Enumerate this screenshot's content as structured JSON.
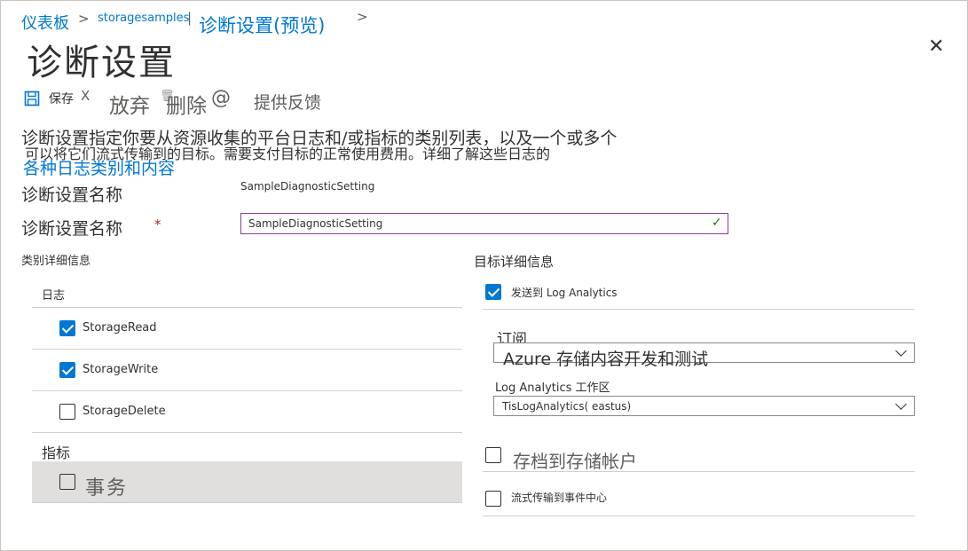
{
  "breadcrumb": {
    "items": [
      "仪表板",
      "storagesamples",
      "诊断设置(预览)"
    ],
    "separators": [
      ">",
      "|",
      ">"
    ]
  },
  "page_title": "诊断设置",
  "toolbar": {
    "save_icon": "save-icon",
    "save_label": "保存",
    "discard_x": "X",
    "discard_label": "放弃",
    "delete_icon": "trash-icon",
    "delete_label": "删除",
    "feedback_icon": "@",
    "feedback_label": "提供反馈"
  },
  "description": {
    "line1": "诊断设置指定你要从资源收集的平台日志和/或指标的类别列表，以及一个或多个",
    "line2": "可以将它们流式传输到的目标。需要支付目标的正常使用费用。详细了解这些日志的",
    "link": "各种日志类别和内容"
  },
  "setting_name": {
    "label": "诊断设置名称",
    "value": "SampleDiagnosticSetting",
    "label2": "诊断设置名称",
    "required_mark": "*",
    "input_value": "SampleDiagnosticSetting"
  },
  "category_details": {
    "header": "类别详细信息",
    "logs_label": "日志",
    "logs": [
      {
        "label": "StorageRead",
        "checked": true
      },
      {
        "label": "StorageWrite",
        "checked": true
      },
      {
        "label": "StorageDelete",
        "checked": false
      }
    ],
    "metrics_label": "指标",
    "metrics": [
      {
        "label": "事务",
        "checked": false
      }
    ]
  },
  "destination_details": {
    "header": "目标详细信息",
    "send_to_log_analytics": {
      "label": "发送到 Log Analytics",
      "checked": true
    },
    "subscription": {
      "label": "订阅",
      "value": "Azure 存储内容开发和测试"
    },
    "workspace": {
      "label": "Log  Analytics 工作区",
      "value": "TisLogAnalytics(   eastus)"
    },
    "archive": {
      "label": "存档到存储帐户",
      "checked": false
    },
    "stream": {
      "label": "流式传输到事件中心",
      "checked": false
    }
  },
  "colors": {
    "accent": "#0078d4",
    "required": "#a4262c",
    "input_border": "#8a3c9b",
    "valid_check": "#107c10"
  }
}
